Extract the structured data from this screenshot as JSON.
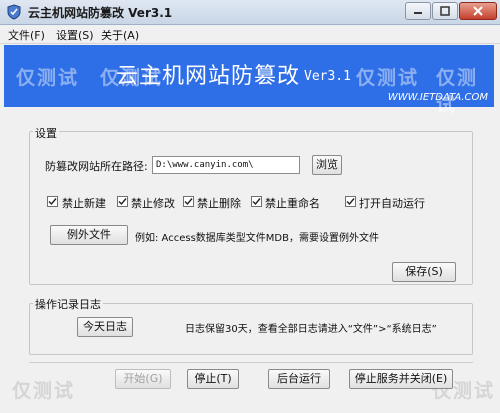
{
  "window": {
    "title": "云主机网站防篡改 Ver3.1"
  },
  "menu": {
    "items": [
      "文件(F)",
      "设置(S)",
      "关于(A)"
    ]
  },
  "banner": {
    "title": "云主机网站防篡改",
    "version": "Ver3.1",
    "url": "WWW.IETDATA.COM",
    "color": "#2e6ee6"
  },
  "watermark": "仅测试",
  "settings": {
    "label": "设置",
    "path_label": "防篡改网站所在路径:",
    "path_value": "D:\\www.canyin.com\\",
    "browse_label": "浏览",
    "checkboxes": [
      {
        "label": "禁止新建",
        "checked": true
      },
      {
        "label": "禁止修改",
        "checked": true
      },
      {
        "label": "禁止删除",
        "checked": true
      },
      {
        "label": "禁止重命名",
        "checked": true
      },
      {
        "label": "打开自动运行",
        "checked": true
      }
    ],
    "exception_button": "例外文件",
    "exception_hint": "例如: Access数据库类型文件MDB，需要设置例外文件",
    "save_button": "保存(S)"
  },
  "log": {
    "label": "操作记录日志",
    "today_button": "今天日志",
    "note": "日志保留30天，查看全部日志请进入“文件”>“系统日志”"
  },
  "footer": {
    "start": "开始(G)",
    "stop": "停止(T)",
    "background": "后台运行",
    "stop_close": "停止服务并关闭(E)"
  }
}
